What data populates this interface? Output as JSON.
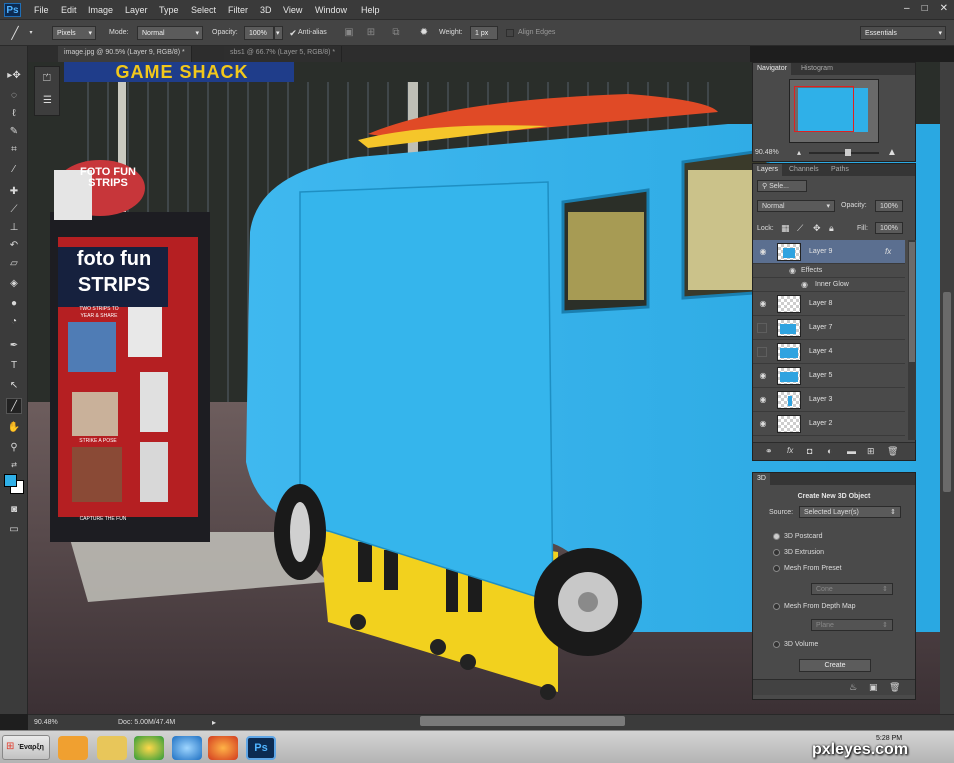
{
  "app": {
    "logo": "Ps"
  },
  "menu": [
    "File",
    "Edit",
    "Image",
    "Layer",
    "Type",
    "Select",
    "Filter",
    "3D",
    "View",
    "Window",
    "Help"
  ],
  "window_controls": [
    "–",
    "□",
    "✕"
  ],
  "options": {
    "pixels": "Pixels",
    "mode_label": "Mode:",
    "mode_value": "Normal",
    "opacity_label": "Opacity:",
    "opacity_value": "100%",
    "antialias": "Anti-alias",
    "weight_label": "Weight:",
    "weight_value": "1 px",
    "align_edges": "Align Edges",
    "workspace": "Essentials"
  },
  "tabs": [
    {
      "label": "image.jpg @ 90.5% (Layer 9, RGB/8) *",
      "active": true
    },
    {
      "label": "sbs1 @ 66.7% (Layer 5, RGB/8) *",
      "active": false
    }
  ],
  "canvas_text": {
    "sign_top": "GAME SHACK",
    "booth_logo": "FOTO FUN STRIPS",
    "booth_title_1": "foto fun",
    "booth_title_2": "STRIPS",
    "booth_sub_1": "TWO STRIPS TO",
    "booth_sub_2": "YEAR & SHARE",
    "booth_sub_3": "STRIKE A POSE",
    "booth_sub_4": "CAPTURE THE FUN"
  },
  "navigator": {
    "tabs": [
      "Navigator",
      "Histogram"
    ],
    "zoom": "90.48%"
  },
  "layers": {
    "tabs": [
      "Layers",
      "Channels",
      "Paths"
    ],
    "kind": "Sele...",
    "blend": "Normal",
    "opacity_label": "Opacity:",
    "opacity_value": "100%",
    "lock_label": "Lock:",
    "fill_label": "Fill:",
    "fill_value": "100%",
    "rows": [
      {
        "name": "Layer 9",
        "visible": true,
        "selected": true,
        "fx": "fx"
      },
      {
        "name": "Effects",
        "visible": true,
        "sub": true
      },
      {
        "name": "Inner Glow",
        "visible": true,
        "sub": true
      },
      {
        "name": "Layer 8",
        "visible": true
      },
      {
        "name": "Layer 7",
        "visible": false
      },
      {
        "name": "Layer 4",
        "visible": false
      },
      {
        "name": "Layer 5",
        "visible": true
      },
      {
        "name": "Layer 3",
        "visible": true
      },
      {
        "name": "Layer 2",
        "visible": true
      }
    ]
  },
  "panel3d": {
    "tab": "3D",
    "title": "Create New 3D Object",
    "source_label": "Source:",
    "source_value": "Selected Layer(s)",
    "options": [
      {
        "label": "3D Postcard",
        "selected": true
      },
      {
        "label": "3D Extrusion",
        "selected": false
      },
      {
        "label": "Mesh From Preset",
        "selected": false
      },
      {
        "label": "Mesh From Depth Map",
        "selected": false
      },
      {
        "label": "3D Volume",
        "selected": false
      }
    ],
    "preset_value": "Cone",
    "depth_value": "Plane",
    "create_button": "Create"
  },
  "status": {
    "zoom": "90.48%",
    "doc": "Doc: 5.00M/47.4M"
  },
  "taskbar": {
    "start": "Έναρξη",
    "clock": "5:28 PM"
  },
  "watermark": "pxleyes.com",
  "colors": {
    "van_blue": "#2fb0e8",
    "yellow": "#f2d11e",
    "ui_dark": "#3b3b3b",
    "selected_layer": "#5b6f90"
  }
}
